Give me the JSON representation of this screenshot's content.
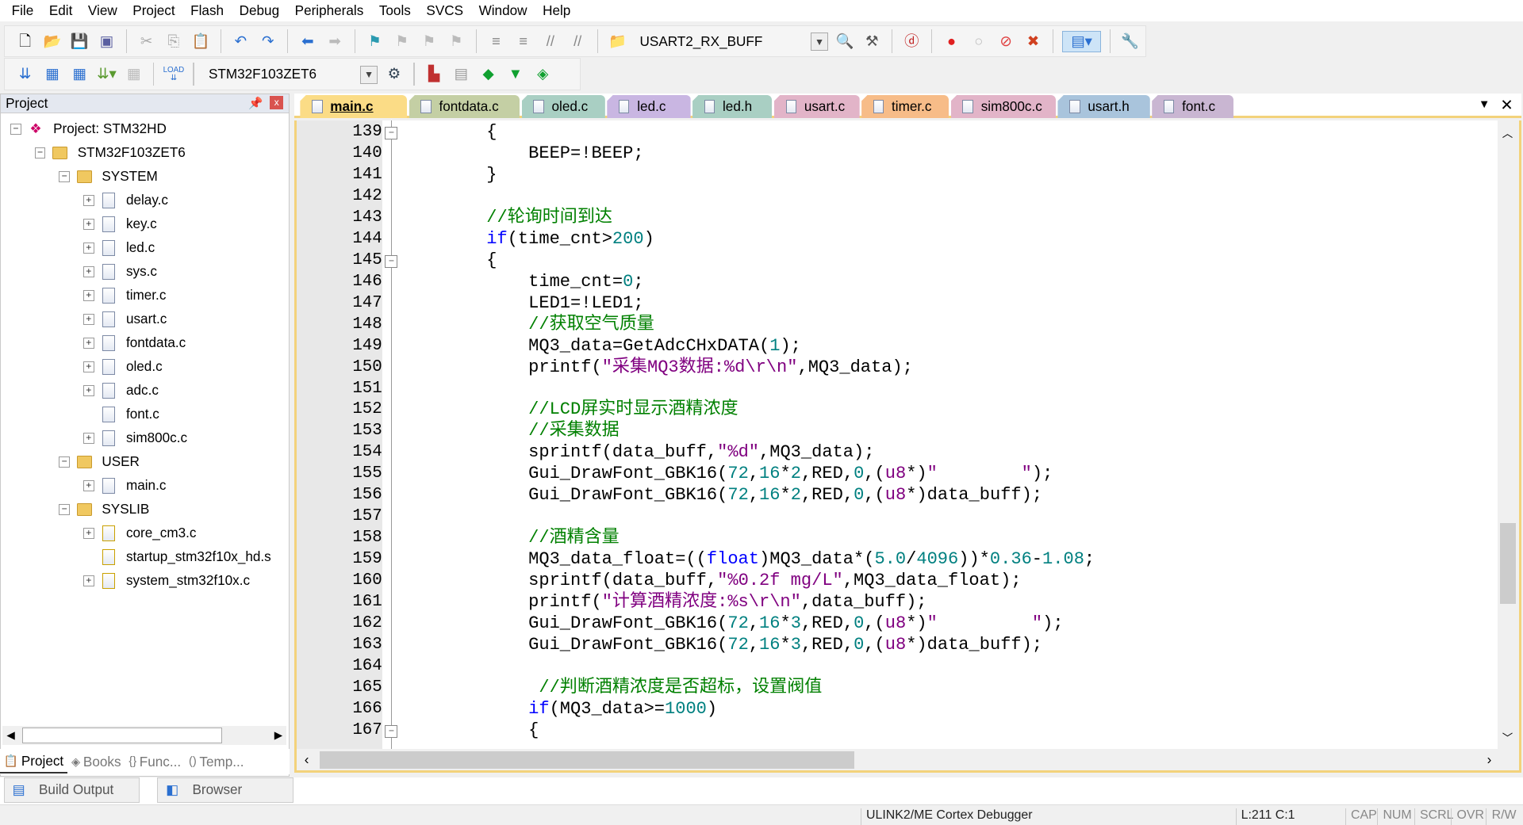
{
  "menu": [
    "File",
    "Edit",
    "View",
    "Project",
    "Flash",
    "Debug",
    "Peripherals",
    "Tools",
    "SVCS",
    "Window",
    "Help"
  ],
  "toolbar1": {
    "find_combo_value": "USART2_RX_BUFF"
  },
  "toolbar2": {
    "target_combo_value": "STM32F103ZET6",
    "load_label": "LOAD"
  },
  "project_panel": {
    "title": "Project",
    "tree": [
      {
        "label": "Project: STM32HD",
        "level": 0,
        "type": "project",
        "toggle": "-"
      },
      {
        "label": "STM32F103ZET6",
        "level": 1,
        "type": "target",
        "toggle": "-"
      },
      {
        "label": "SYSTEM",
        "level": 2,
        "type": "folder",
        "toggle": "-"
      },
      {
        "label": "delay.c",
        "level": 3,
        "type": "file",
        "toggle": "+"
      },
      {
        "label": "key.c",
        "level": 3,
        "type": "file",
        "toggle": "+"
      },
      {
        "label": "led.c",
        "level": 3,
        "type": "file",
        "toggle": "+"
      },
      {
        "label": "sys.c",
        "level": 3,
        "type": "file",
        "toggle": "+"
      },
      {
        "label": "timer.c",
        "level": 3,
        "type": "file",
        "toggle": "+"
      },
      {
        "label": "usart.c",
        "level": 3,
        "type": "file",
        "toggle": "+"
      },
      {
        "label": "fontdata.c",
        "level": 3,
        "type": "file",
        "toggle": "+"
      },
      {
        "label": "oled.c",
        "level": 3,
        "type": "file",
        "toggle": "+"
      },
      {
        "label": "adc.c",
        "level": 3,
        "type": "file",
        "toggle": "+"
      },
      {
        "label": "font.c",
        "level": 3,
        "type": "file",
        "toggle": ""
      },
      {
        "label": "sim800c.c",
        "level": 3,
        "type": "file",
        "toggle": "+"
      },
      {
        "label": "USER",
        "level": 2,
        "type": "folder",
        "toggle": "-"
      },
      {
        "label": "main.c",
        "level": 3,
        "type": "file",
        "toggle": "+"
      },
      {
        "label": "SYSLIB",
        "level": 2,
        "type": "folder",
        "toggle": "-"
      },
      {
        "label": "core_cm3.c",
        "level": 3,
        "type": "libfile",
        "toggle": "+"
      },
      {
        "label": "startup_stm32f10x_hd.s",
        "level": 3,
        "type": "libfile",
        "toggle": ""
      },
      {
        "label": "system_stm32f10x.c",
        "level": 3,
        "type": "libfile",
        "toggle": "+"
      }
    ],
    "tabs": [
      "Project",
      "Books",
      "Func...",
      "Temp..."
    ]
  },
  "editor_tabs": [
    {
      "label": "main.c",
      "color": "#fbdc86",
      "active": true
    },
    {
      "label": "fontdata.c",
      "color": "#c4cfa4"
    },
    {
      "label": "oled.c",
      "color": "#a9cfc3"
    },
    {
      "label": "led.c",
      "color": "#c9b6e2"
    },
    {
      "label": "led.h",
      "color": "#a9cfc3"
    },
    {
      "label": "usart.c",
      "color": "#e2b4c8"
    },
    {
      "label": "timer.c",
      "color": "#f7bc88"
    },
    {
      "label": "sim800c.c",
      "color": "#e2b4c8"
    },
    {
      "label": "usart.h",
      "color": "#a9c4dc"
    },
    {
      "label": "font.c",
      "color": "#c9b6d2"
    }
  ],
  "code": [
    {
      "n": "139",
      "fold": "-",
      "t": [
        [
          "",
          "        {"
        ]
      ]
    },
    {
      "n": "140",
      "t": [
        [
          "",
          "            BEEP=!BEEP;"
        ]
      ]
    },
    {
      "n": "141",
      "t": [
        [
          "",
          "        }"
        ]
      ]
    },
    {
      "n": "142",
      "t": []
    },
    {
      "n": "143",
      "t": [
        [
          "cmt",
          "        //轮询时间到达"
        ]
      ]
    },
    {
      "n": "144",
      "t": [
        [
          "kw",
          "        if"
        ],
        [
          "",
          "(time_cnt>"
        ],
        [
          "num",
          "200"
        ],
        [
          "",
          ")"
        ]
      ]
    },
    {
      "n": "145",
      "fold": "-",
      "t": [
        [
          "",
          "        {"
        ]
      ]
    },
    {
      "n": "146",
      "t": [
        [
          "",
          "            time_cnt="
        ],
        [
          "num",
          "0"
        ],
        [
          "",
          ";"
        ]
      ]
    },
    {
      "n": "147",
      "t": [
        [
          "",
          "            LED1=!LED1;"
        ]
      ]
    },
    {
      "n": "148",
      "t": [
        [
          "cmt",
          "            //获取空气质量"
        ]
      ]
    },
    {
      "n": "149",
      "t": [
        [
          "",
          "            MQ3_data=GetAdcCHxDATA("
        ],
        [
          "num",
          "1"
        ],
        [
          "",
          ");"
        ]
      ]
    },
    {
      "n": "150",
      "t": [
        [
          "",
          "            printf("
        ],
        [
          "str",
          "\"采集MQ3数据:%d\\r\\n\""
        ],
        [
          "",
          ",MQ3_data);"
        ]
      ]
    },
    {
      "n": "151",
      "t": []
    },
    {
      "n": "152",
      "t": [
        [
          "cmt",
          "            //LCD屏实时显示酒精浓度"
        ]
      ]
    },
    {
      "n": "153",
      "t": [
        [
          "cmt",
          "            //采集数据"
        ]
      ]
    },
    {
      "n": "154",
      "t": [
        [
          "",
          "            sprintf(data_buff,"
        ],
        [
          "str",
          "\"%d\""
        ],
        [
          "",
          ",MQ3_data);"
        ]
      ]
    },
    {
      "n": "155",
      "t": [
        [
          "",
          "            Gui_DrawFont_GBK16("
        ],
        [
          "num",
          "72"
        ],
        [
          "",
          ","
        ],
        [
          "num",
          "16"
        ],
        [
          "",
          "*"
        ],
        [
          "num",
          "2"
        ],
        [
          "",
          ",RED,"
        ],
        [
          "num",
          "0"
        ],
        [
          "",
          ",("
        ],
        [
          "str",
          "u8"
        ],
        [
          "",
          "*)"
        ],
        [
          "str",
          "\"        \""
        ],
        [
          "",
          ");"
        ]
      ]
    },
    {
      "n": "156",
      "t": [
        [
          "",
          "            Gui_DrawFont_GBK16("
        ],
        [
          "num",
          "72"
        ],
        [
          "",
          ","
        ],
        [
          "num",
          "16"
        ],
        [
          "",
          "*"
        ],
        [
          "num",
          "2"
        ],
        [
          "",
          ",RED,"
        ],
        [
          "num",
          "0"
        ],
        [
          "",
          ",("
        ],
        [
          "str",
          "u8"
        ],
        [
          "",
          "*)data_buff);"
        ]
      ]
    },
    {
      "n": "157",
      "t": []
    },
    {
      "n": "158",
      "t": [
        [
          "cmt",
          "            //酒精含量"
        ]
      ]
    },
    {
      "n": "159",
      "t": [
        [
          "",
          "            MQ3_data_float=(("
        ],
        [
          "kw",
          "float"
        ],
        [
          "",
          ")MQ3_data*("
        ],
        [
          "num",
          "5.0"
        ],
        [
          "",
          "/"
        ],
        [
          "num",
          "4096"
        ],
        [
          "",
          "))*"
        ],
        [
          "num",
          "0.36"
        ],
        [
          "",
          "-"
        ],
        [
          "num",
          "1.08"
        ],
        [
          "",
          ";"
        ]
      ]
    },
    {
      "n": "160",
      "t": [
        [
          "",
          "            sprintf(data_buff,"
        ],
        [
          "str",
          "\"%0.2f mg/L\""
        ],
        [
          "",
          ",MQ3_data_float);"
        ]
      ]
    },
    {
      "n": "161",
      "t": [
        [
          "",
          "            printf("
        ],
        [
          "str",
          "\"计算酒精浓度:%s\\r\\n\""
        ],
        [
          "",
          ",data_buff);"
        ]
      ]
    },
    {
      "n": "162",
      "t": [
        [
          "",
          "            Gui_DrawFont_GBK16("
        ],
        [
          "num",
          "72"
        ],
        [
          "",
          ","
        ],
        [
          "num",
          "16"
        ],
        [
          "",
          "*"
        ],
        [
          "num",
          "3"
        ],
        [
          "",
          ",RED,"
        ],
        [
          "num",
          "0"
        ],
        [
          "",
          ",("
        ],
        [
          "str",
          "u8"
        ],
        [
          "",
          "*)"
        ],
        [
          "str",
          "\"         \""
        ],
        [
          "",
          ");"
        ]
      ]
    },
    {
      "n": "163",
      "t": [
        [
          "",
          "            Gui_DrawFont_GBK16("
        ],
        [
          "num",
          "72"
        ],
        [
          "",
          ","
        ],
        [
          "num",
          "16"
        ],
        [
          "",
          "*"
        ],
        [
          "num",
          "3"
        ],
        [
          "",
          ",RED,"
        ],
        [
          "num",
          "0"
        ],
        [
          "",
          ",("
        ],
        [
          "str",
          "u8"
        ],
        [
          "",
          "*)data_buff);"
        ]
      ]
    },
    {
      "n": "164",
      "t": []
    },
    {
      "n": "165",
      "t": [
        [
          "cmt",
          "             //判断酒精浓度是否超标，设置阀值"
        ]
      ]
    },
    {
      "n": "166",
      "t": [
        [
          "kw",
          "            if"
        ],
        [
          "",
          "(MQ3_data>="
        ],
        [
          "num",
          "1000"
        ],
        [
          "",
          ")"
        ]
      ]
    },
    {
      "n": "167",
      "fold": "-",
      "t": [
        [
          "",
          "            {"
        ]
      ]
    }
  ],
  "output_tabs": [
    "Build Output",
    "Browser"
  ],
  "status": {
    "debugger": "ULINK2/ME Cortex Debugger",
    "position": "L:211 C:1",
    "cap": "CAP",
    "num": "NUM",
    "scrl": "SCRL",
    "ovr": "OVR",
    "rw": "R/W"
  }
}
